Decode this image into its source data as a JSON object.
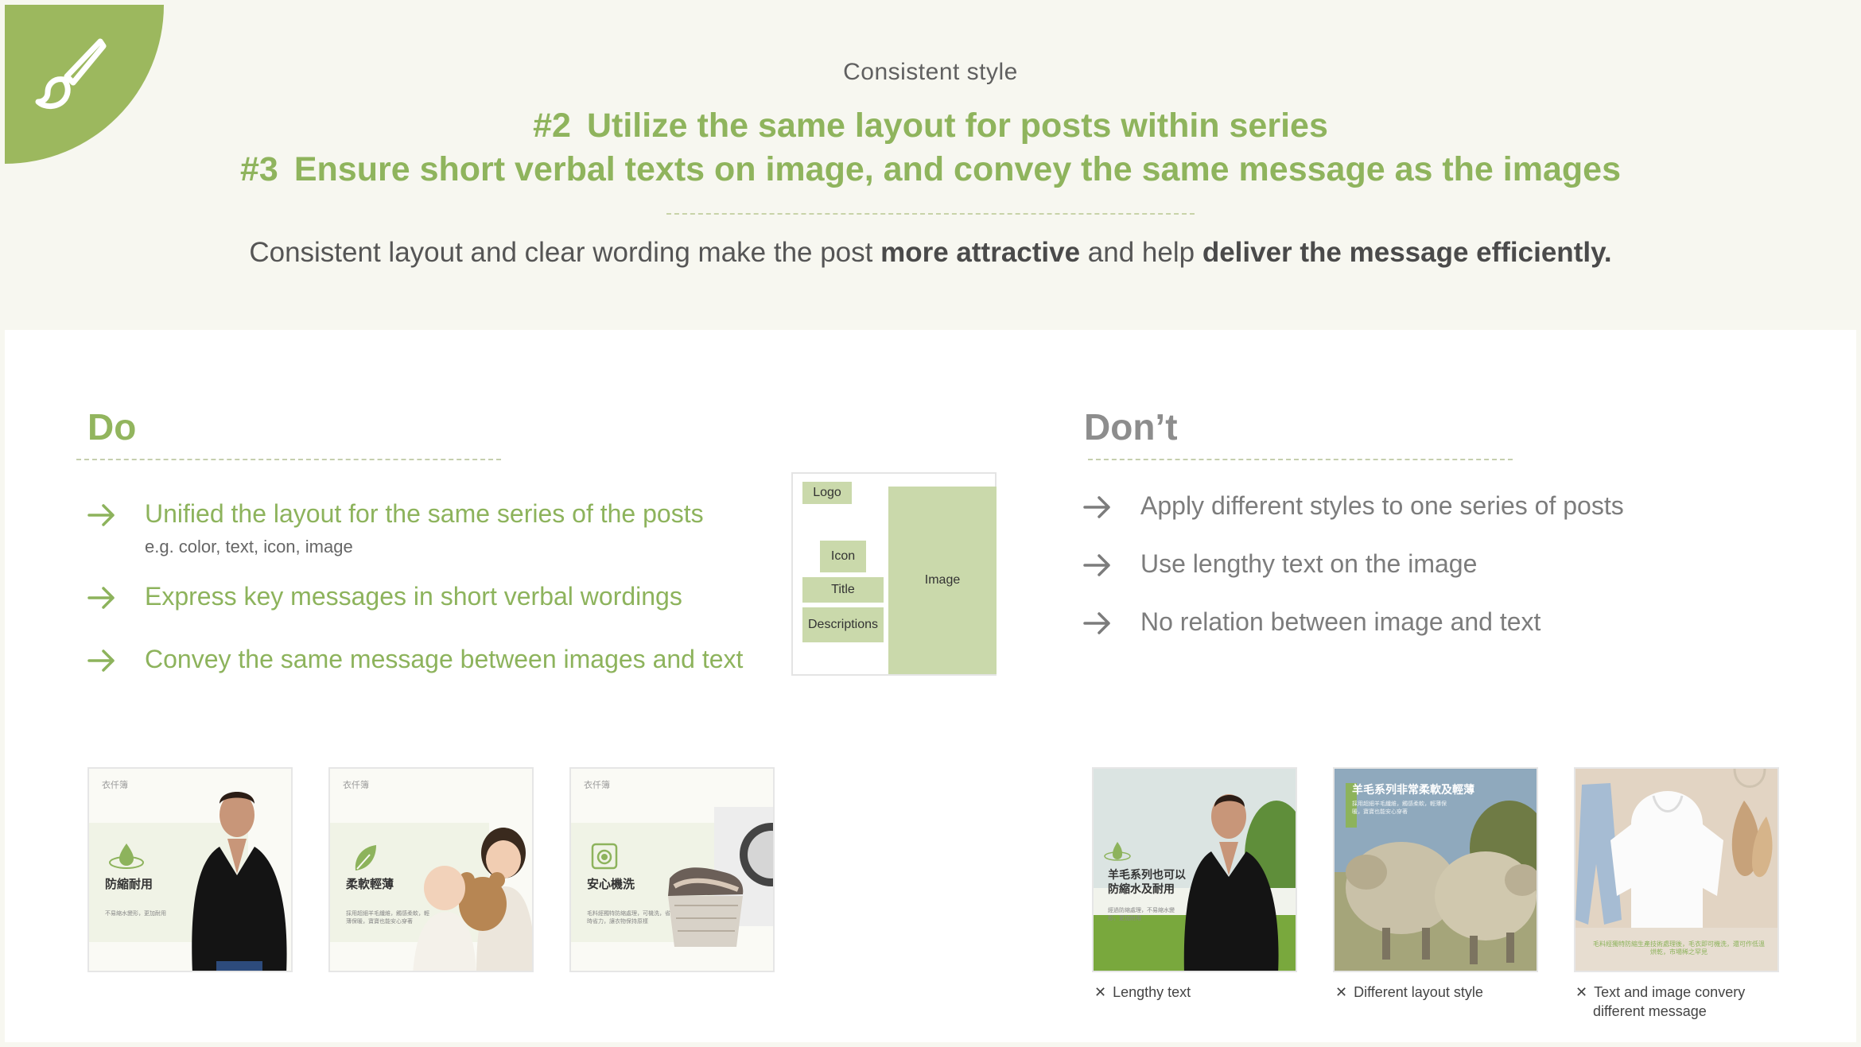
{
  "header": {
    "eyebrow": "Consistent style",
    "title_1_num": "#2",
    "title_1_text": "Utilize the same layout for posts within series",
    "title_2_num": "#3",
    "title_2_text": "Ensure short verbal texts on image, and convey the same message as the images",
    "lead_pre": "Consistent layout and clear wording make the post ",
    "lead_b1": "more attractive",
    "lead_mid": " and help ",
    "lead_b2": "deliver the message efficiently."
  },
  "do": {
    "title": "Do",
    "items": [
      {
        "text": "Unified the layout for the same series of the posts",
        "sub": "e.g. color, text, icon, image"
      },
      {
        "text": "Express key messages in short verbal wordings"
      },
      {
        "text": "Convey the same message between images and text"
      }
    ],
    "schema": {
      "logo": "Logo",
      "icon": "Icon",
      "title": "Title",
      "desc": "Descriptions",
      "image": "Image"
    },
    "thumbs": [
      {
        "brand": "衣仟簿",
        "heading": "防縮耐用",
        "sub": "不易縮水變形，更加耐用"
      },
      {
        "brand": "衣仟簿",
        "heading": "柔軟輕薄",
        "sub": "採用超細羊毛纖維，觸感柔軟，輕薄保暖，寶寶也能安心穿著"
      },
      {
        "brand": "衣仟簿",
        "heading": "安心機洗",
        "sub": "毛料經獨特防縮處理，可機洗，省時省力，讓衣物保持原樣"
      }
    ]
  },
  "dont": {
    "title": "Don’t",
    "items": [
      {
        "text": "Apply different styles to one series of posts"
      },
      {
        "text": "Use lengthy text on the image"
      },
      {
        "text": "No relation between image and text"
      }
    ],
    "thumbs": [
      {
        "heading": "羊毛系列也可以防縮水及耐用",
        "sub": "經過防縮處理，不易縮水變形，更加耐用",
        "caption": "Lengthy text"
      },
      {
        "heading": "羊毛系列非常柔軟及輕薄",
        "sub": "採用超細羊毛纖維，觸感柔軟，輕薄保暖，寶寶也能安心穿著",
        "caption": "Different layout style"
      },
      {
        "sub": "毛料經獨特防縮生產技術處理後，毛衣即可機洗，還可作低溫烘乾，市場稀之罕見",
        "caption_1": "Text and image convery",
        "caption_2": "different message"
      }
    ]
  },
  "colors": {
    "accent": "#92b55e",
    "bg": "#f7f7f0",
    "schema_fill": "#cad9ab"
  }
}
